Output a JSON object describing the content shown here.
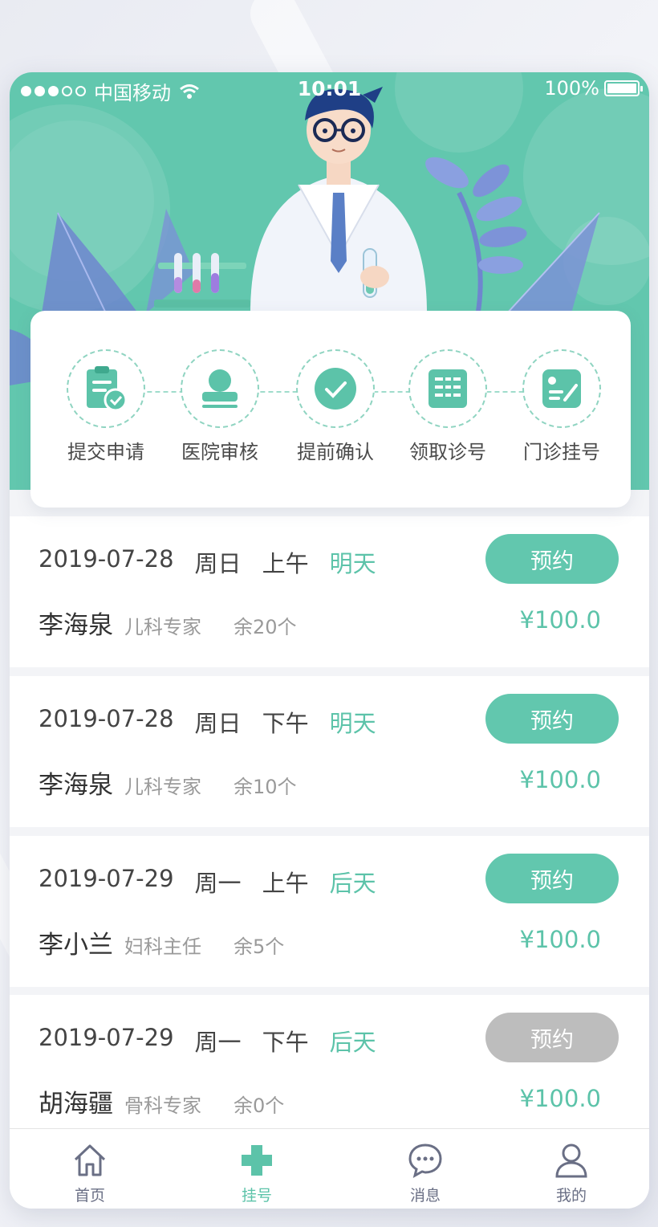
{
  "status_bar": {
    "carrier": "中国移动",
    "time": "10:01",
    "battery": "100%",
    "battery_level": 1.0
  },
  "colors": {
    "accent": "#62c7ae",
    "accent_text": "#5cc3a9",
    "disabled": "#bdbdbd"
  },
  "steps": [
    {
      "label": "提交申请",
      "icon": "clipboard-check-icon"
    },
    {
      "label": "医院审核",
      "icon": "stamp-icon"
    },
    {
      "label": "提前确认",
      "icon": "check-circle-icon"
    },
    {
      "label": "领取诊号",
      "icon": "number-list-icon"
    },
    {
      "label": "门诊挂号",
      "icon": "edit-card-icon"
    }
  ],
  "appointments": [
    {
      "date": "2019-07-28",
      "weekday": "周日",
      "period": "上午",
      "relative": "明天",
      "doctor": "李海泉",
      "title": "儿科专家",
      "remaining": "余20个",
      "price": "¥100.0",
      "button": "预约",
      "available": true
    },
    {
      "date": "2019-07-28",
      "weekday": "周日",
      "period": "下午",
      "relative": "明天",
      "doctor": "李海泉",
      "title": "儿科专家",
      "remaining": "余10个",
      "price": "¥100.0",
      "button": "预约",
      "available": true
    },
    {
      "date": "2019-07-29",
      "weekday": "周一",
      "period": "上午",
      "relative": "后天",
      "doctor": "李小兰",
      "title": "妇科主任",
      "remaining": "余5个",
      "price": "¥100.0",
      "button": "预约",
      "available": true
    },
    {
      "date": "2019-07-29",
      "weekday": "周一",
      "period": "下午",
      "relative": "后天",
      "doctor": "胡海疆",
      "title": "骨科专家",
      "remaining": "余0个",
      "price": "¥100.0",
      "button": "预约",
      "available": false
    }
  ],
  "tabbar": {
    "items": [
      {
        "label": "首页",
        "icon": "home-icon",
        "active": false
      },
      {
        "label": "挂号",
        "icon": "medical-cross-icon",
        "active": true
      },
      {
        "label": "消息",
        "icon": "message-icon",
        "active": false
      },
      {
        "label": "我的",
        "icon": "user-icon",
        "active": false
      }
    ]
  }
}
